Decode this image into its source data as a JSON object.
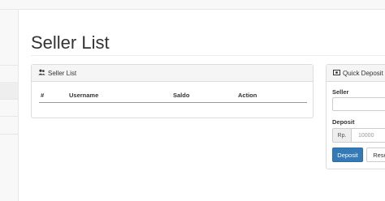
{
  "page": {
    "title": "Seller List"
  },
  "seller_panel": {
    "heading": "Seller List",
    "heading_icon": "users-icon",
    "columns": [
      "#",
      "Username",
      "Saldo",
      "Action"
    ]
  },
  "deposit_panel": {
    "heading": "Quick Deposit",
    "heading_icon": "money-icon",
    "seller_label": "Seller",
    "deposit_label": "Deposit",
    "currency_addon": "Rp.",
    "amount_placeholder": "10000",
    "deposit_button": "Deposit",
    "reset_button": "Reset"
  },
  "colors": {
    "primary": "#337ab7",
    "panel_heading_bg": "#f5f5f5",
    "border": "#dddddd"
  }
}
